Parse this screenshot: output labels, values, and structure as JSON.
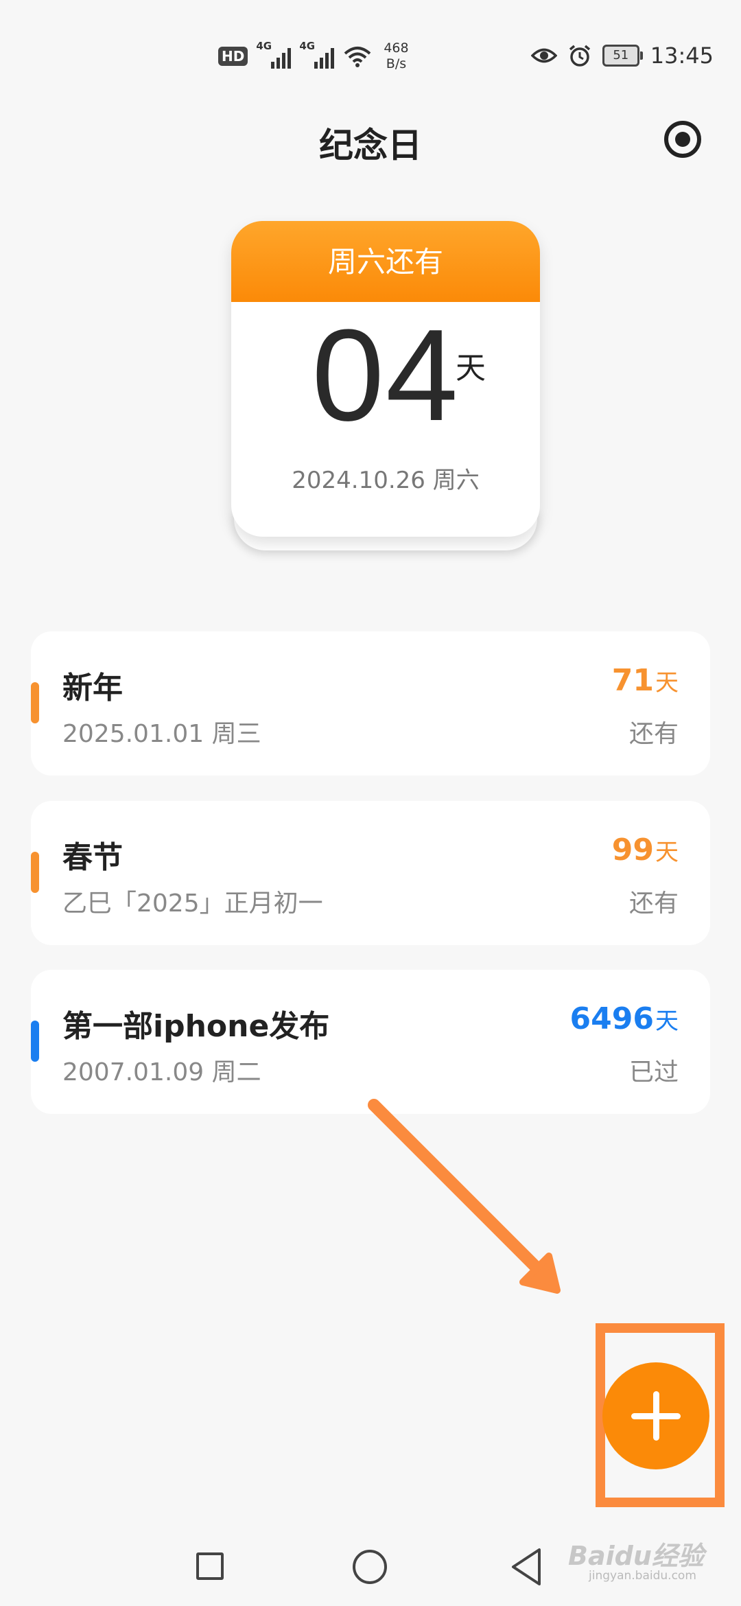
{
  "status_bar": {
    "hd": "HD",
    "signal1": "4G",
    "signal2": "4G",
    "net_speed_value": "468",
    "net_speed_unit": "B/s",
    "battery": "51",
    "time": "13:45"
  },
  "header": {
    "title": "纪念日"
  },
  "featured": {
    "label": "周六还有",
    "days": "04",
    "unit": "天",
    "date": "2024.10.26 周六"
  },
  "events": [
    {
      "name": "新年",
      "date": "2025.01.01 周三",
      "count": "71",
      "unit": "天",
      "status": "还有",
      "color": "#f7922f"
    },
    {
      "name": "春节",
      "date": "乙巳「2025」正月初一",
      "count": "99",
      "unit": "天",
      "status": "还有",
      "color": "#f7922f"
    },
    {
      "name": "第一部iphone发布",
      "date": "2007.01.09 周二",
      "count": "6496",
      "unit": "天",
      "status": "已过",
      "color": "#1a7ef0"
    }
  ],
  "colors": {
    "accent": "#fb8a08",
    "past": "#1a7ef0",
    "annotation": "#fb8b3e"
  },
  "watermark": {
    "brand": "Baidu经验",
    "url": "jingyan.baidu.com"
  }
}
